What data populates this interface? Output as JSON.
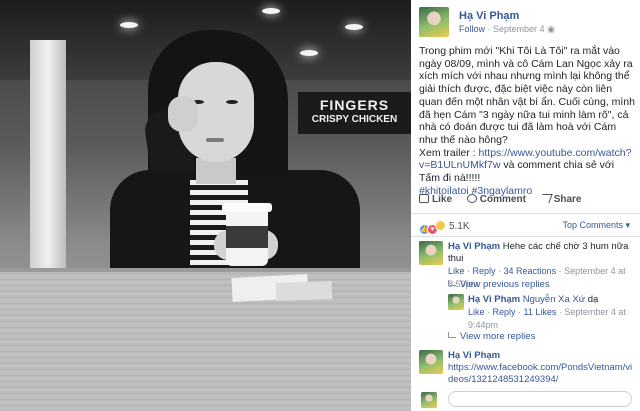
{
  "post": {
    "author": "Hạ Vi Phạm",
    "follow": "Follow",
    "date": "September 4",
    "body_text": "Trong phim mới \"Khi Tôi Là Tôi\" ra mắt vào ngày 08/09, mình và cô Cám Lan Ngọc xảy ra xích mích với nhau nhưng mình lại không thể giải thích được, đặc biệt việc này còn liên quan đến một nhân vật bí ẩn. Cuối cùng, mình đã hẹn Cám \"3 ngày nữa tui minh làm rõ\", cả nhà có đoán được tui đã làm hoà với Cám như thế nào hông?",
    "trailer_prefix": "Xem trailer : ",
    "trailer_link": "https://www.youtube.com/watch?v=B1ULnUMkf7w",
    "trailer_suffix": " và comment chia sẻ với Tấm đi nà!!!!!",
    "hashtags": "#khitoilatoi #3ngaylamro"
  },
  "actions": {
    "like": "Like",
    "comment": "Comment",
    "share": "Share"
  },
  "reactions": {
    "count": "5.1K",
    "top_comments": "Top Comments ▾"
  },
  "comments": [
    {
      "author": "Hạ Vi Phạm",
      "text": " Hehe các chế chờ 3 hum nữa thui",
      "like": "Like",
      "reply": "Reply",
      "reactions": "34 Reactions",
      "date": "September 4 at 8:59pm"
    }
  ],
  "view_previous_replies": "View previous replies",
  "reply": {
    "author": "Hạ Vi Phạm",
    "mention": "Nguyễn Xa Xứ",
    "text": " dạ",
    "like": "Like",
    "reply": "Reply",
    "likes": "11 Likes",
    "date": "September 4 at 9:44pm"
  },
  "view_more_replies": "View more replies",
  "comment3": {
    "author": "Hạ Vi Phạm",
    "link": "https://www.facebook.com/PondsVietnam/videos/1321248531249394/"
  },
  "photo": {
    "sign_line1": "FINGERS",
    "sign_line2": "CRISPY CHICKEN"
  }
}
